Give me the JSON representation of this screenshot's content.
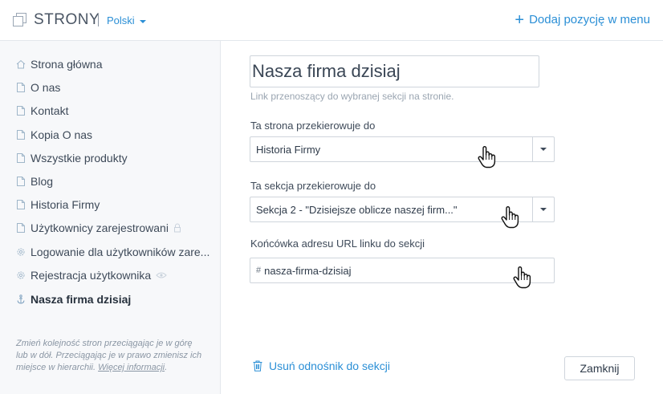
{
  "header": {
    "title": "STRONY",
    "language": "Polski",
    "add_menu_label": "Dodaj pozycję w menu",
    "icons": {
      "pages": "pages-icon",
      "language_caret": "caret-down-icon",
      "add": "plus-icon"
    }
  },
  "sidebar": {
    "items": [
      {
        "label": "Strona główna",
        "icon": "home-icon"
      },
      {
        "label": "O nas",
        "icon": "page-icon"
      },
      {
        "label": "Kontakt",
        "icon": "page-icon"
      },
      {
        "label": "Kopia O nas",
        "icon": "page-icon"
      },
      {
        "label": "Wszystkie produkty",
        "icon": "page-icon"
      },
      {
        "label": "Blog",
        "icon": "page-icon"
      },
      {
        "label": "Historia Firmy",
        "icon": "page-icon"
      },
      {
        "label": "Użytkownicy zarejestrowani",
        "icon": "page-icon",
        "trail_icon": "lock-icon"
      },
      {
        "label": "Logowanie dla użytkowników zare...",
        "icon": "gear-icon"
      },
      {
        "label": "Rejestracja użytkownika",
        "icon": "gear-icon",
        "trail_icon": "eye-icon"
      },
      {
        "label": "Nasza firma dzisiaj",
        "icon": "anchor-icon",
        "active": true
      }
    ],
    "hint_text": "Zmień kolejność stron przeciągając je w górę lub w dół. Przeciągając je w prawo zmienisz ich miejsce w hierarchii.",
    "hint_link": "Więcej informacji"
  },
  "form": {
    "name_value": "Nasza firma dzisiaj",
    "name_help": "Link przenoszący do wybranej sekcji na stronie.",
    "page_label": "Ta strona przekierowuje do",
    "page_value": "Historia Firmy",
    "section_label": "Ta sekcja przekierowuje do",
    "section_value": "Sekcja 2 - \"Dzisiejsze oblicze naszej firm...\"",
    "url_label": "Końcówka adresu URL linku do sekcji",
    "url_prefix": "#",
    "url_value": "nasza-firma-dzisiaj",
    "remove_label": "Usuń odnośnik do sekcji",
    "close_label": "Zamknij"
  },
  "colors": {
    "accent": "#2b8fd6",
    "sidebar_bg": "#f7f8fa",
    "border": "#cfd5dc"
  }
}
